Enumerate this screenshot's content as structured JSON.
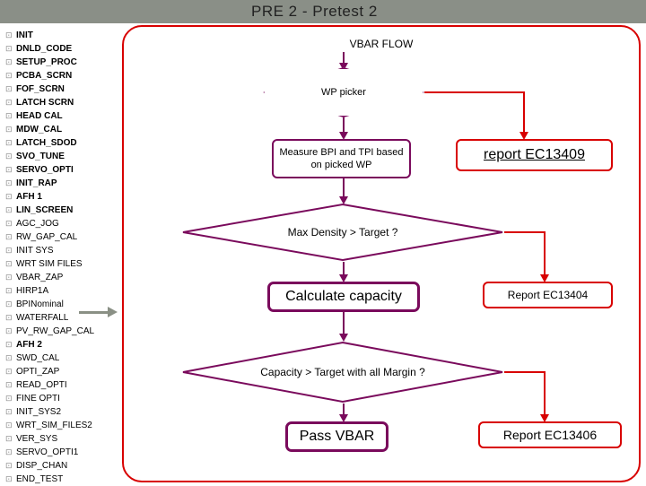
{
  "header": {
    "title": "PRE 2 - Pretest 2"
  },
  "sidebar": {
    "items": [
      {
        "label": "INIT",
        "bold": true
      },
      {
        "label": "DNLD_CODE",
        "bold": true
      },
      {
        "label": "SETUP_PROC",
        "bold": true
      },
      {
        "label": "PCBA_SCRN",
        "bold": true
      },
      {
        "label": "FOF_SCRN",
        "bold": true
      },
      {
        "label": "LATCH SCRN",
        "bold": true
      },
      {
        "label": "HEAD CAL",
        "bold": true
      },
      {
        "label": "MDW_CAL",
        "bold": true
      },
      {
        "label": "LATCH_SDOD",
        "bold": true
      },
      {
        "label": "SVO_TUNE",
        "bold": true
      },
      {
        "label": "SERVO_OPTI",
        "bold": true
      },
      {
        "label": "INIT_RAP",
        "bold": true
      },
      {
        "label": "AFH 1",
        "bold": true
      },
      {
        "label": "LIN_SCREEN",
        "bold": true
      },
      {
        "label": "AGC_JOG",
        "bold": false
      },
      {
        "label": "RW_GAP_CAL",
        "bold": false
      },
      {
        "label": "INIT SYS",
        "bold": false
      },
      {
        "label": "WRT SIM FILES",
        "bold": false
      },
      {
        "label": "VBAR_ZAP",
        "bold": false
      },
      {
        "label": "HIRP1A",
        "bold": false
      },
      {
        "label": "BPINominal",
        "bold": false
      },
      {
        "label": "WATERFALL",
        "bold": false
      },
      {
        "label": "PV_RW_GAP_CAL",
        "bold": false
      },
      {
        "label": "AFH 2",
        "bold": true
      },
      {
        "label": "SWD_CAL",
        "bold": false
      },
      {
        "label": "OPTI_ZAP",
        "bold": false
      },
      {
        "label": "READ_OPTI",
        "bold": false
      },
      {
        "label": "FINE OPTI",
        "bold": false
      },
      {
        "label": "INIT_SYS2",
        "bold": false
      },
      {
        "label": "WRT_SIM_FILES2",
        "bold": false
      },
      {
        "label": "VER_SYS",
        "bold": false
      },
      {
        "label": "SERVO_OPTI1",
        "bold": false
      },
      {
        "label": "DISP_CHAN",
        "bold": false
      },
      {
        "label": "END_TEST",
        "bold": false
      }
    ]
  },
  "flow": {
    "title": "VBAR FLOW",
    "wp_picker": "WP picker",
    "measure": "Measure BPI and TPI based on picked WP",
    "report1": "report EC13409",
    "density_q": "Max Density > Target ?",
    "calc": "Calculate capacity",
    "report2": "Report EC13404",
    "capacity_q": "Capacity > Target with all Margin ?",
    "pass": "Pass VBAR",
    "report3": "Report EC13406"
  }
}
